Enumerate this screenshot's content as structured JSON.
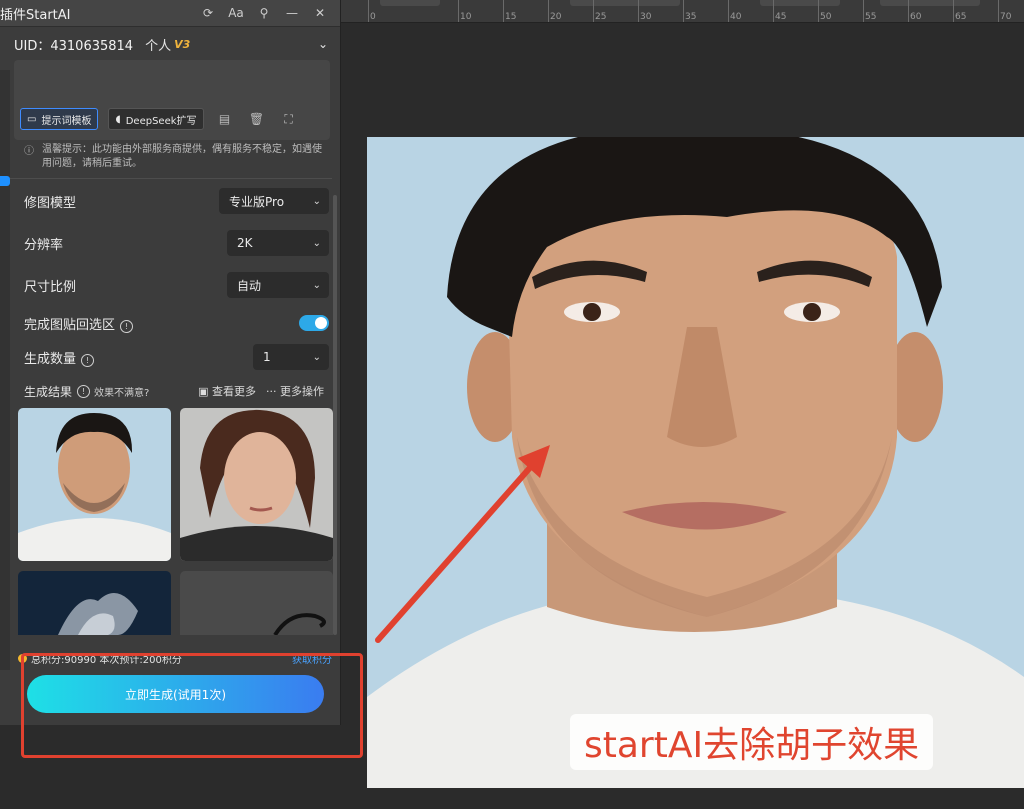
{
  "ruler": {
    "ticks": [
      "0",
      "10",
      "15",
      "20",
      "25",
      "30",
      "35",
      "40",
      "45",
      "50",
      "55",
      "60",
      "65",
      "70"
    ]
  },
  "panel": {
    "title": "插件StartAI",
    "uid": "UID：4310635814",
    "account_type": "个人",
    "version_badge": "V3",
    "prompt_template_label": "提示词模板",
    "deepseek_label": "DeepSeek扩写",
    "notice": "温馨提示：此功能由外部服务商提供，偶有服务不稳定，如遇使用问题，请稍后重试。",
    "model": {
      "label": "修图模型",
      "value": "专业版Pro"
    },
    "resolution": {
      "label": "分辨率",
      "value": "2K"
    },
    "aspect": {
      "label": "尺寸比例",
      "value": "自动"
    },
    "paste_back": {
      "label": "完成图贴回选区",
      "on": true
    },
    "count": {
      "label": "生成数量",
      "value": "1"
    },
    "results": {
      "label": "生成结果",
      "unsatisfied": "效果不满意?",
      "view_more": "查看更多",
      "more_actions": "更多操作"
    },
    "credits_text": "总积分:90990  本次预计:200积分",
    "get_credits": "获取积分",
    "generate_button": "立即生成(试用1次)"
  },
  "canvas": {
    "caption": "startAI去除胡子效果"
  },
  "colors": {
    "accent": "#2da9e8",
    "highlight_red": "#e0412f",
    "photo_bg": "#b9d4e4"
  }
}
